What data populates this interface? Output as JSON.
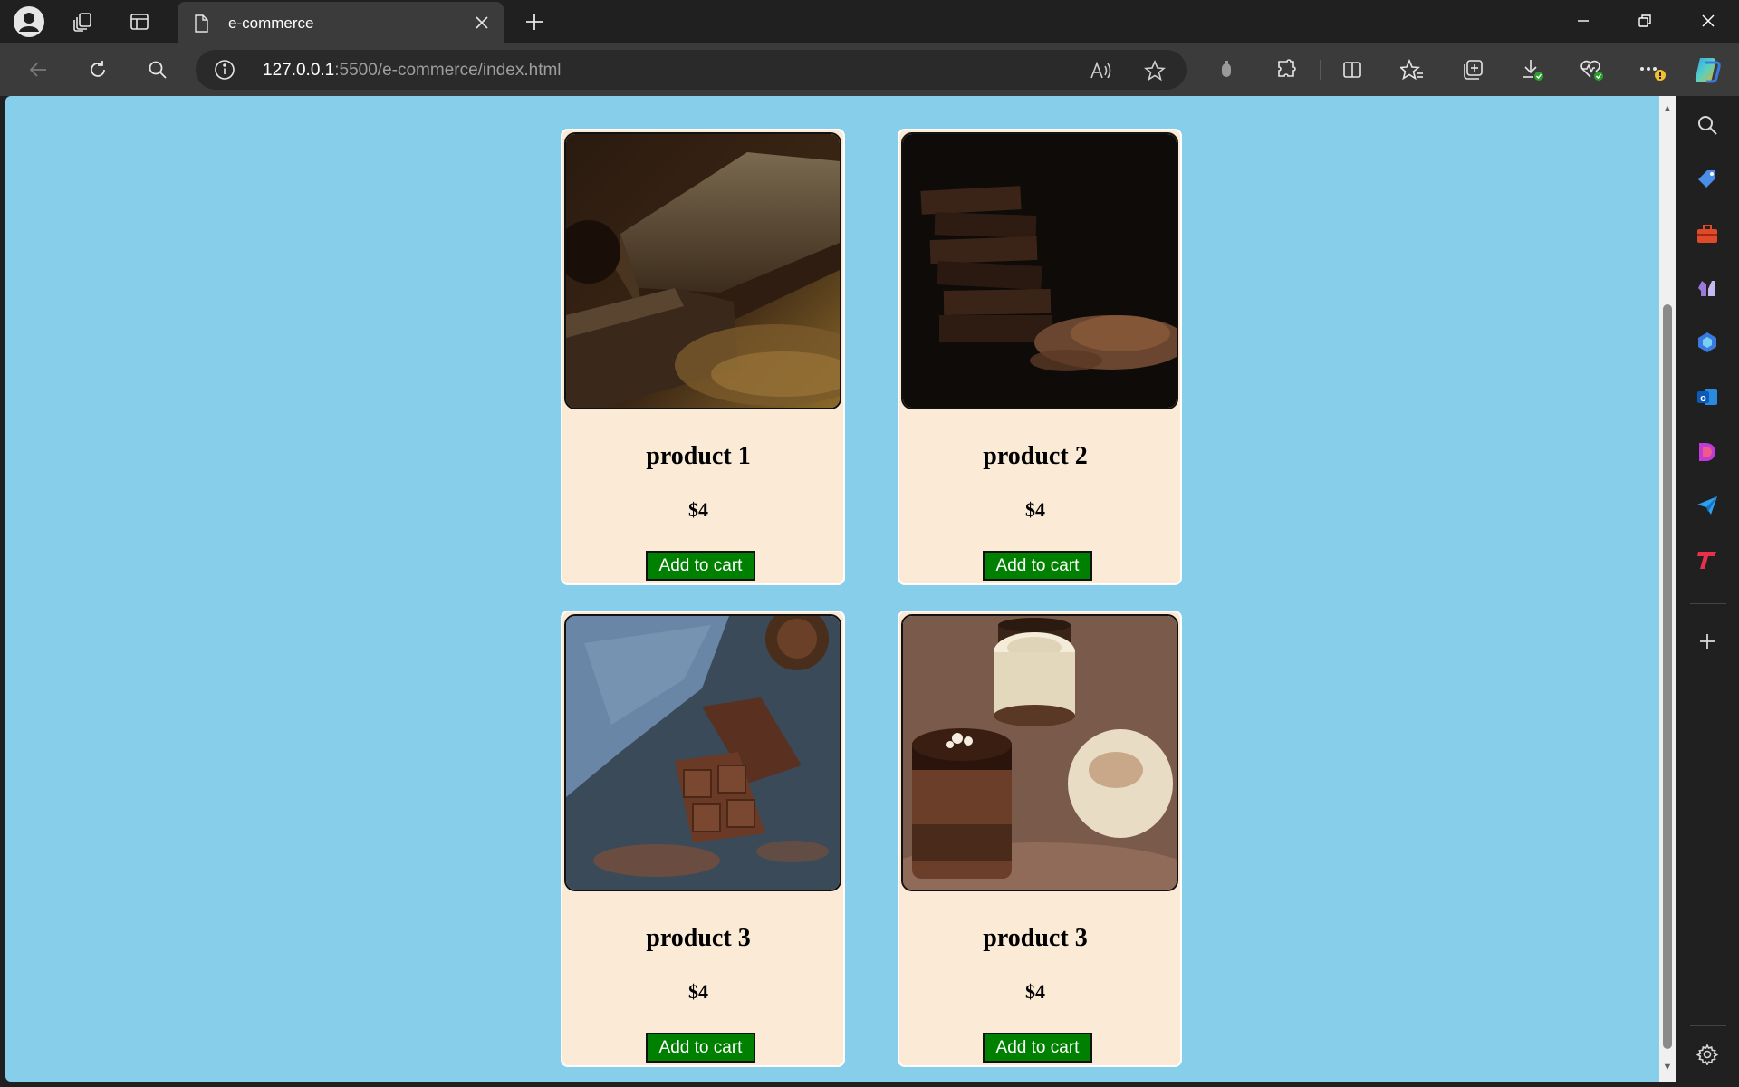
{
  "tabs": [
    {
      "title": "e-commerce"
    }
  ],
  "address_bar": {
    "host": "127.0.0.1",
    "path": ":5500/e-commerce/index.html"
  },
  "icons": {
    "profile": "profile-icon",
    "workspaces": "workspaces-icon",
    "tab_actions": "tab-actions-icon",
    "page": "page-icon",
    "close_tab": "close-icon",
    "new_tab": "plus-icon",
    "minimize": "minimize-icon",
    "restore": "restore-icon",
    "close_window": "close-icon",
    "back": "back-arrow-icon",
    "refresh": "refresh-icon",
    "search": "search-icon",
    "site_info": "info-icon",
    "read_aloud": "read-aloud-icon",
    "favorite": "star-icon",
    "extensions": "puzzle-icon",
    "split_screen": "split-screen-icon",
    "favorites": "favorites-icon",
    "collections": "collections-icon",
    "downloads": "download-icon",
    "browser_essentials": "heart-pulse-icon",
    "more": "more-icon",
    "copilot": "copilot-icon"
  },
  "products": [
    {
      "name": "product 1",
      "price": "$4",
      "button": "Add to cart"
    },
    {
      "name": "product 2",
      "price": "$4",
      "button": "Add to cart"
    },
    {
      "name": "product 3",
      "price": "$4",
      "button": "Add to cart"
    },
    {
      "name": "product 3",
      "price": "$4",
      "button": "Add to cart"
    }
  ],
  "colors": {
    "page_background": "#87ceeb",
    "card_background": "#fbead6",
    "button_background": "#008000",
    "browser_chrome": "#202020",
    "toolbar": "#3b3b3b"
  }
}
